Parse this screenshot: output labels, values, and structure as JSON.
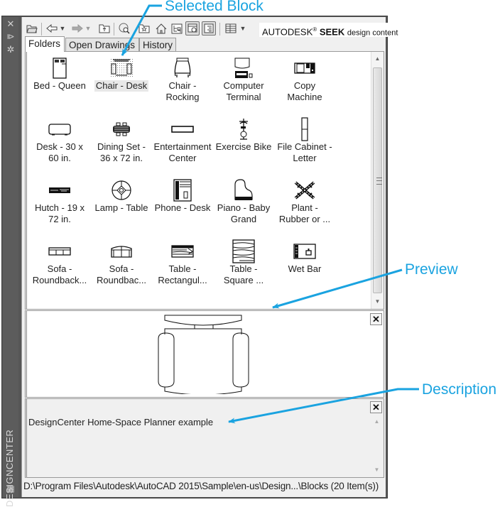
{
  "callouts": {
    "selected_block": "Selected Block",
    "preview": "Preview",
    "description": "Description"
  },
  "palette": {
    "title": "DESIGNCENTER"
  },
  "toolbar": {
    "buttons": [
      "load-icon",
      "back-icon",
      "back-dropdown",
      "forward-icon",
      "forward-dropdown",
      "up-icon",
      "search-icon",
      "favorites-icon",
      "home-icon",
      "tree-view-toggle-icon",
      "preview-toggle-icon",
      "description-toggle-icon",
      "views-icon",
      "views-dropdown"
    ],
    "seek_brand": "AUTODESK",
    "seek_reg": "®",
    "seek_bold": "SEEK",
    "seek_tail": "design content"
  },
  "tabs": [
    {
      "label": "Folders",
      "active": true
    },
    {
      "label": "Open Drawings",
      "active": false
    },
    {
      "label": "History",
      "active": false
    }
  ],
  "items": [
    {
      "label": "Bed - Queen",
      "icon": "bed-icon"
    },
    {
      "label": "Chair - Desk",
      "icon": "chair-desk-icon",
      "selected": true
    },
    {
      "label": "Chair - Rocking",
      "icon": "chair-rocking-icon"
    },
    {
      "label": "Computer Terminal",
      "icon": "computer-terminal-icon"
    },
    {
      "label": "Copy Machine",
      "icon": "copy-machine-icon"
    },
    {
      "label": "Desk - 30 x 60 in.",
      "icon": "desk-icon"
    },
    {
      "label": "Dining Set - 36 x 72 in.",
      "icon": "dining-set-icon"
    },
    {
      "label": "Entertainment Center",
      "icon": "entertainment-center-icon"
    },
    {
      "label": "Exercise Bike",
      "icon": "exercise-bike-icon"
    },
    {
      "label": "File Cabinet - Letter",
      "icon": "file-cabinet-icon"
    },
    {
      "label": "Hutch - 19 x 72 in.",
      "icon": "hutch-icon"
    },
    {
      "label": "Lamp - Table",
      "icon": "lamp-icon"
    },
    {
      "label": "Phone - Desk",
      "icon": "phone-icon"
    },
    {
      "label": "Piano - Baby Grand",
      "icon": "piano-icon"
    },
    {
      "label": "Plant - Rubber or ...",
      "icon": "plant-icon"
    },
    {
      "label": "Sofa - Roundback...",
      "icon": "sofa-icon"
    },
    {
      "label": "Sofa - Roundbac...",
      "icon": "sofa-roundback-icon"
    },
    {
      "label": "Table - Rectangul...",
      "icon": "table-rectangular-icon"
    },
    {
      "label": "Table - Square ...",
      "icon": "table-square-icon"
    },
    {
      "label": "Wet Bar",
      "icon": "wet-bar-icon"
    }
  ],
  "description": {
    "text": "DesignCenter Home-Space Planner example"
  },
  "status": {
    "path": "D:\\Program Files\\Autodesk\\AutoCAD 2015\\Sample\\en-us\\Design...\\Blocks (20 Item(s))"
  },
  "close_glyph": "✕",
  "colors": {
    "callout": "#1aa3e0",
    "palette_bg": "#5c5c5c"
  }
}
